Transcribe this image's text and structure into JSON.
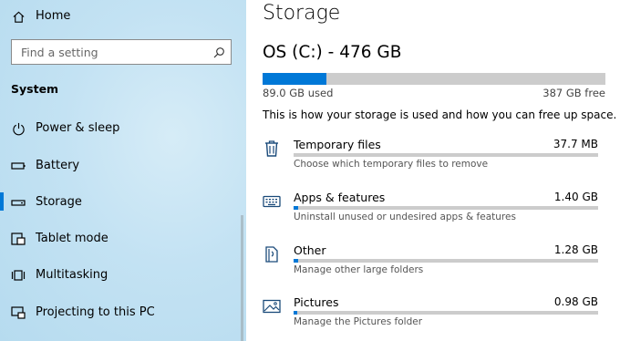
{
  "sidebar": {
    "home_label": "Home",
    "search_placeholder": "Find a setting",
    "section_title": "System",
    "items": [
      {
        "label": "Power & sleep",
        "icon": "power-icon"
      },
      {
        "label": "Battery",
        "icon": "battery-icon"
      },
      {
        "label": "Storage",
        "icon": "storage-icon",
        "active": true
      },
      {
        "label": "Tablet mode",
        "icon": "tablet-mode-icon"
      },
      {
        "label": "Multitasking",
        "icon": "multitasking-icon"
      },
      {
        "label": "Projecting to this PC",
        "icon": "projecting-icon"
      }
    ]
  },
  "main": {
    "title": "Storage",
    "drive": {
      "name": "OS (C:) - 476 GB",
      "used_label": "89.0 GB used",
      "free_label": "387 GB free",
      "used_fraction": 0.187
    },
    "description": "This is how your storage is used and how you can free up space.",
    "categories": [
      {
        "name": "Temporary files",
        "size": "37.7 MB",
        "sub": "Choose which temporary files to remove",
        "icon": "trash-icon",
        "fraction": 0.0
      },
      {
        "name": "Apps & features",
        "size": "1.40 GB",
        "sub": "Uninstall unused or undesired apps & features",
        "icon": "keyboard-icon",
        "fraction": 0.016
      },
      {
        "name": "Other",
        "size": "1.28 GB",
        "sub": "Manage other large folders",
        "icon": "other-document-icon",
        "fraction": 0.015
      },
      {
        "name": "Pictures",
        "size": "0.98 GB",
        "sub": "Manage the Pictures folder",
        "icon": "pictures-icon",
        "fraction": 0.012
      }
    ]
  },
  "colors": {
    "accent": "#0078d7",
    "bar_background": "#cccccc",
    "sidebar_background": "#c3e2f3"
  }
}
